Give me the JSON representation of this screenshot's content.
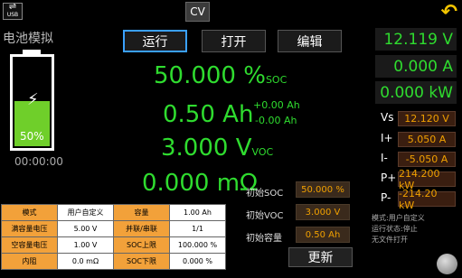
{
  "top": {
    "usb_label": "USB",
    "mode": "CV",
    "back_icon": "back-arrow-icon"
  },
  "title": "电池模拟",
  "tabs": [
    {
      "label": "运行",
      "active": true
    },
    {
      "label": "打开",
      "active": false
    },
    {
      "label": "编辑",
      "active": false
    }
  ],
  "battery": {
    "percent_label": "50%",
    "level": 0.5,
    "timer": "00:00:00",
    "color": "#6fcf2a"
  },
  "readings": {
    "soc_value": "50.000 %",
    "soc_unit": "SOC",
    "ah_value": "0.50 Ah",
    "ah_plus": "+0.00 Ah",
    "ah_minus": "-0.00 Ah",
    "voc_value": "3.000 V",
    "voc_unit": "VOC",
    "res_value": "0.000 mΩ"
  },
  "initial": [
    {
      "label": "初始SOC",
      "value": "50.000 %"
    },
    {
      "label": "初始VOC",
      "value": "3.000 V"
    },
    {
      "label": "初始容量",
      "value": "0.50 Ah"
    }
  ],
  "update_label": "更新",
  "params_table": [
    [
      "模式",
      "用户自定义",
      "容量",
      "1.00 Ah"
    ],
    [
      "满容量电压",
      "5.00 V",
      "并联/串联",
      "1/1"
    ],
    [
      "空容量电压",
      "1.00 V",
      "SOC上限",
      "100.000 %"
    ],
    [
      "内阻",
      "0.0 mΩ",
      "SOC下限",
      "0.000 %"
    ]
  ],
  "right_panel": {
    "voltage": "12.119 V",
    "current": "0.000 A",
    "power": "0.000 kW",
    "limits": [
      {
        "label": "Vs",
        "value": "12.120 V"
      },
      {
        "label": "I+",
        "value": "5.050 A"
      },
      {
        "label": "I-",
        "value": "-5.050 A"
      },
      {
        "label": "P+",
        "value": "214.200 kW"
      },
      {
        "label": "P-",
        "value": "-214.20 kW"
      }
    ],
    "status_lines": [
      "模式:用户自定义",
      "运行状态:停止",
      "无文件打开"
    ]
  },
  "colors": {
    "accent_green": "#2fdc2f",
    "accent_orange": "#f0a000",
    "tab_active_border": "#3aa0ff"
  }
}
